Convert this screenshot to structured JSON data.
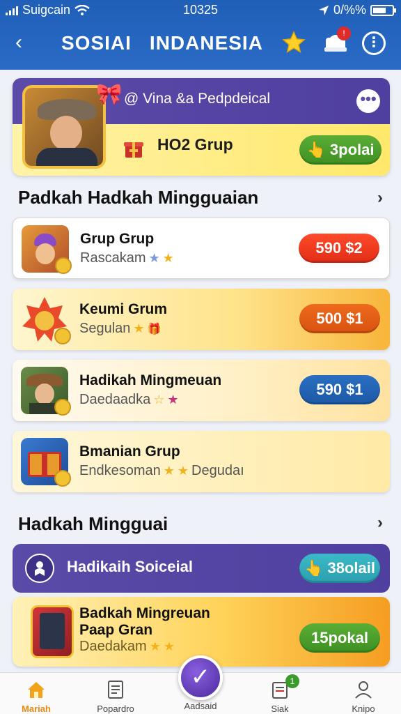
{
  "status": {
    "carrier": "Suigcain",
    "time": "10325",
    "battery": "0/%%"
  },
  "header": {
    "title_left": "SOSIAI",
    "title_right": "INDANESIA",
    "bell_badge": "!"
  },
  "feature": {
    "handle": "@ Vina &a Pedpdeical",
    "group": "HO2 Grup",
    "button": "3polai"
  },
  "section1": {
    "title": "Padkah Hadkah Mingguaian"
  },
  "list": [
    {
      "name": "Grup Grup",
      "sub": "Rascakam",
      "button": "590 $2",
      "color": "red"
    },
    {
      "name": "Keumi Grum",
      "sub": "Segulan",
      "button": "500 $1",
      "color": "orange"
    },
    {
      "name": "Hadikah Mingmeuan",
      "sub": "Daedaadka",
      "button": "590 $1",
      "color": "blue"
    },
    {
      "name": "Bmanian Grup",
      "sub": "Endkesoman",
      "sub2": "Degudaı"
    }
  ],
  "section2": {
    "title": "Hadkah Mingguai"
  },
  "purple_row": {
    "label": "Hadikaih Soiceial",
    "button": "38olail"
  },
  "badge_card": {
    "line1": "Badkah Mingreuan",
    "line2": "Paap Gran",
    "sub": "Daedakam",
    "button": "15pokal"
  },
  "tabs": [
    {
      "label": "Mariah"
    },
    {
      "label": "Popardro"
    },
    {
      "label": "Aadsaid"
    },
    {
      "label": "Siak",
      "badge": "1"
    },
    {
      "label": "Knipo"
    }
  ],
  "colors": {
    "header": "#2a6bc6",
    "purple": "#5a4ba8",
    "accent": "#f2b21b"
  }
}
